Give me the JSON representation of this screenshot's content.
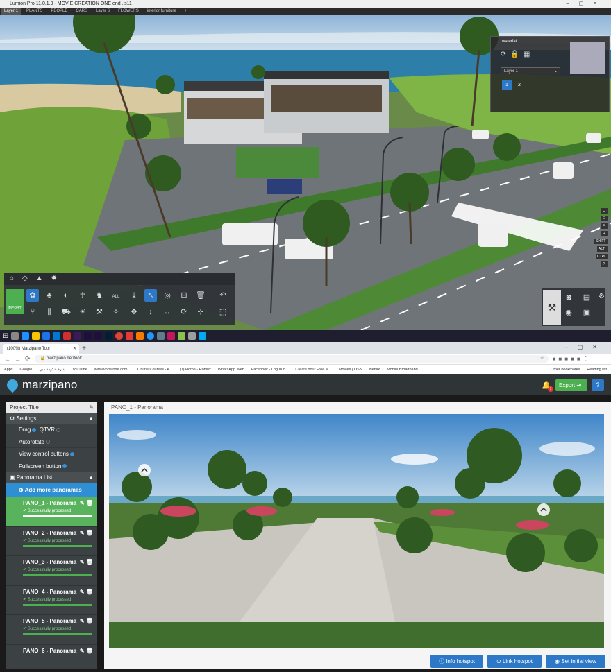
{
  "lumion": {
    "title": "Lumion Pro 11.0.1.9 - MOVIE CREATION ONE end .ls11",
    "tabs": [
      "Layer 1",
      "PLANTS",
      "PEOPLE",
      "CARS",
      "Layer 6",
      "FLOWERS",
      "interior furniture"
    ],
    "panel": {
      "object_name": "waterfall",
      "layer": "Layer 1",
      "pages": [
        "1",
        "2"
      ]
    },
    "toolbar": {
      "import_label": "IMPORT",
      "all_label": "ALL"
    },
    "shortcuts": [
      "Q",
      "E",
      "F",
      "R",
      "SHIFT",
      "ALT",
      "CTRL",
      "?"
    ]
  },
  "browser": {
    "tab_title": "(100%) Marzipano Tool",
    "url": "marzipano.net/tool/",
    "bookmarks": [
      "Apps",
      "Google",
      "إدارة حكومة دبي",
      "YouTube",
      "www.vodafone.com...",
      "Online Courses - A...",
      "(1) Home - Roblox",
      "WhatsApp Web",
      "Facebook - Log In o...",
      "Create Your Free M...",
      "Movies | OSN",
      "Netflix",
      "Mobile Broadband",
      "Other bookmarks",
      "Reading list"
    ]
  },
  "app": {
    "logo_text": "marzipano",
    "export_label": "Export",
    "help_label": "?",
    "notif_count": "1"
  },
  "sidebar": {
    "project_title": "Project Title",
    "settings_label": "Settings",
    "drag_label": "Drag",
    "qtvr_label": "QTVR",
    "autorotate_label": "Autorotate",
    "view_control_label": "View control buttons",
    "fullscreen_label": "Fullscreen button",
    "pano_list_label": "Panorama List",
    "add_more_label": "Add more panoramas",
    "panos": [
      {
        "name": "PANO_1 - Panorama",
        "status": "Successfully processed"
      },
      {
        "name": "PANO_2 - Panorama",
        "status": "Successfully processed"
      },
      {
        "name": "PANO_3 - Panorama",
        "status": "Successfully processed"
      },
      {
        "name": "PANO_4 - Panorama",
        "status": "Successfully processed"
      },
      {
        "name": "PANO_5 - Panorama",
        "status": "Successfully processed"
      },
      {
        "name": "PANO_6 - Panorama",
        "status": ""
      }
    ]
  },
  "viewer": {
    "heading": "PANO_1 - Panorama",
    "info_hotspot": "Info hotspot",
    "link_hotspot": "Link hotspot",
    "set_initial_view": "Set initial view"
  },
  "colors": {
    "accent": "#2e79c7",
    "success": "#59b35c",
    "dark": "#2f3437"
  }
}
